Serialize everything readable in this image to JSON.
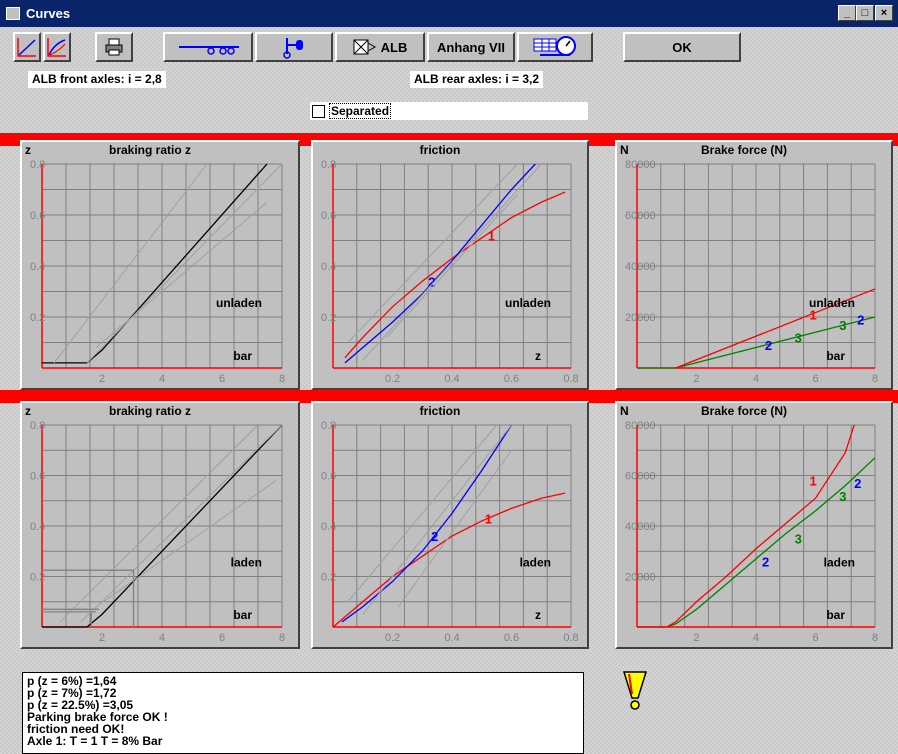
{
  "window": {
    "title": "Curves",
    "minimize": "_",
    "maximize": "□",
    "close": "×"
  },
  "toolbar": {
    "alb_label": "ALB",
    "anhang_label": "Anhang VII",
    "ok_label": "OK"
  },
  "info": {
    "front": "ALB front axles:   i = 2,8",
    "rear": "ALB rear axles:   i = 3,2"
  },
  "separated": {
    "label": "Separated",
    "checked": false
  },
  "colors": {
    "red": "#ff0000",
    "blue": "#0000ff",
    "green": "#008000",
    "grid": "#7f7f7f"
  },
  "log_lines": [
    "p (z = 6%) =1,64",
    "p (z = 7%) =1,72",
    "p (z = 22.5%) =3,05",
    "Parking brake force OK !",
    "friction need OK!",
    "Axle 1: T = 1 T = 8% Bar"
  ],
  "warning_icon": "exclamation-warning-icon",
  "chart_data": [
    {
      "type": "line",
      "title": "braking ratio z",
      "corner_label": "z",
      "annotation": "unladen",
      "xlabel": "bar",
      "xlim": [
        0,
        8
      ],
      "ylim": [
        0,
        0.8
      ],
      "xticks": [
        "2",
        "4",
        "6",
        "8"
      ],
      "yticks": [
        "0.2",
        "0.4",
        "0.6",
        "0.8"
      ],
      "series": [
        {
          "color": "#000000",
          "points": [
            [
              0,
              0.02
            ],
            [
              1.5,
              0.02
            ],
            [
              2,
              0.07
            ],
            [
              7.5,
              0.8
            ]
          ]
        },
        {
          "color": "#a0a0a0",
          "points": [
            [
              0.4,
              0.02
            ],
            [
              5.5,
              0.8
            ]
          ]
        },
        {
          "color": "#a0a0a0",
          "points": [
            [
              1.5,
              0.02
            ],
            [
              8,
              0.8
            ]
          ]
        },
        {
          "color": "#a0a0a0",
          "points": [
            [
              1.8,
              0.08
            ],
            [
              7.5,
              0.65
            ]
          ]
        }
      ]
    },
    {
      "type": "line",
      "title": "friction",
      "corner_label": "",
      "annotation": "unladen",
      "xlabel": "z",
      "xlim": [
        0,
        0.8
      ],
      "ylim": [
        0,
        0.8
      ],
      "xticks": [
        "0.2",
        "0.4",
        "0.6",
        "0.8"
      ],
      "yticks": [
        "0.2",
        "0.4",
        "0.6",
        "0.8"
      ],
      "series": [
        {
          "color": "#ff0000",
          "label": "1",
          "label_at": [
            0.52,
            0.5
          ],
          "points": [
            [
              0.04,
              0.04
            ],
            [
              0.1,
              0.12
            ],
            [
              0.2,
              0.24
            ],
            [
              0.3,
              0.34
            ],
            [
              0.4,
              0.43
            ],
            [
              0.5,
              0.51
            ],
            [
              0.6,
              0.59
            ],
            [
              0.7,
              0.65
            ],
            [
              0.78,
              0.69
            ]
          ]
        },
        {
          "color": "#0000ff",
          "label": "2",
          "label_at": [
            0.32,
            0.32
          ],
          "points": [
            [
              0.04,
              0.02
            ],
            [
              0.1,
              0.08
            ],
            [
              0.2,
              0.18
            ],
            [
              0.3,
              0.29
            ],
            [
              0.4,
              0.42
            ],
            [
              0.5,
              0.56
            ],
            [
              0.6,
              0.7
            ],
            [
              0.68,
              0.8
            ]
          ]
        },
        {
          "color": "#a0a0a0",
          "points": [
            [
              0.1,
              0.03
            ],
            [
              0.7,
              0.8
            ]
          ]
        },
        {
          "color": "#a0a0a0",
          "points": [
            [
              0.05,
              0.1
            ],
            [
              0.62,
              0.8
            ]
          ]
        },
        {
          "color": "#a0a0a0",
          "points": [
            [
              0.18,
              0.12
            ],
            [
              0.62,
              0.68
            ]
          ]
        }
      ]
    },
    {
      "type": "line",
      "title": "Brake force (N)",
      "corner_label": "N",
      "annotation": "unladen",
      "xlabel": "bar",
      "xlim": [
        0,
        8
      ],
      "ylim": [
        0,
        80000
      ],
      "xticks": [
        "2",
        "4",
        "6",
        "8"
      ],
      "yticks": [
        "20000",
        "40000",
        "60000",
        "80000"
      ],
      "series": [
        {
          "color": "#008000",
          "points": [
            [
              0,
              0
            ],
            [
              1.3,
              0
            ],
            [
              8,
              20000
            ]
          ]
        },
        {
          "color": "#ff0000",
          "label": "1",
          "label_at": [
            5.8,
            19000
          ],
          "points": [
            [
              1.3,
              0
            ],
            [
              8,
              31000
            ]
          ]
        },
        {
          "color": "#0000ff",
          "label": "2",
          "label_at": [
            4.3,
            7000
          ]
        },
        {
          "color": "#008000",
          "label": "3",
          "label_at": [
            5.3,
            10000
          ]
        },
        {
          "color": "#008000",
          "label": "3",
          "label_at": [
            6.8,
            15000
          ]
        },
        {
          "color": "#0000ff",
          "label": "2",
          "label_at": [
            7.4,
            17000
          ]
        }
      ]
    },
    {
      "type": "line",
      "title": "braking ratio z",
      "corner_label": "z",
      "annotation": "laden",
      "xlabel": "bar",
      "xlim": [
        0,
        8
      ],
      "ylim": [
        0,
        0.8
      ],
      "xticks": [
        "2",
        "4",
        "6",
        "8"
      ],
      "yticks": [
        "0.2",
        "0.4",
        "0.6",
        "0.8"
      ],
      "series": [
        {
          "color": "#000000",
          "points": [
            [
              0,
              0
            ],
            [
              1.5,
              0
            ],
            [
              2,
              0.05
            ],
            [
              8,
              0.8
            ]
          ]
        },
        {
          "color": "#a0a0a0",
          "points": [
            [
              0.6,
              0.02
            ],
            [
              7.2,
              0.8
            ]
          ]
        },
        {
          "color": "#a0a0a0",
          "points": [
            [
              1.3,
              0.02
            ],
            [
              8,
              0.8
            ]
          ]
        },
        {
          "color": "#a0a0a0",
          "points": [
            [
              1.8,
              0.08
            ],
            [
              7.8,
              0.58
            ]
          ]
        },
        {
          "color": "#808080",
          "points": [
            [
              0,
              0.06
            ],
            [
              1.8,
              0.06
            ]
          ]
        },
        {
          "color": "#808080",
          "points": [
            [
              0,
              0.07
            ],
            [
              1.9,
              0.07
            ]
          ]
        },
        {
          "color": "#808080",
          "points": [
            [
              0,
              0.225
            ],
            [
              3.05,
              0.225
            ],
            [
              3.05,
              0
            ]
          ]
        },
        {
          "color": "#808080",
          "points": [
            [
              1.64,
              0
            ],
            [
              1.64,
              0.06
            ]
          ]
        }
      ]
    },
    {
      "type": "line",
      "title": "friction",
      "corner_label": "",
      "annotation": "laden",
      "xlabel": "z",
      "xlim": [
        0,
        0.8
      ],
      "ylim": [
        0,
        0.8
      ],
      "xticks": [
        "0.2",
        "0.4",
        "0.6",
        "0.8"
      ],
      "yticks": [
        "0.2",
        "0.4",
        "0.6",
        "0.8"
      ],
      "series": [
        {
          "color": "#ff0000",
          "label": "1",
          "label_at": [
            0.51,
            0.41
          ],
          "points": [
            [
              0,
              0
            ],
            [
              0.1,
              0.1
            ],
            [
              0.2,
              0.2
            ],
            [
              0.3,
              0.28
            ],
            [
              0.4,
              0.36
            ],
            [
              0.5,
              0.42
            ],
            [
              0.6,
              0.47
            ],
            [
              0.7,
              0.51
            ],
            [
              0.78,
              0.53
            ]
          ]
        },
        {
          "color": "#0000ff",
          "label": "2",
          "label_at": [
            0.33,
            0.34
          ],
          "points": [
            [
              0.03,
              0.02
            ],
            [
              0.1,
              0.08
            ],
            [
              0.2,
              0.18
            ],
            [
              0.3,
              0.3
            ],
            [
              0.4,
              0.45
            ],
            [
              0.5,
              0.62
            ],
            [
              0.6,
              0.8
            ]
          ]
        },
        {
          "color": "#a0a0a0",
          "points": [
            [
              0.1,
              0.05
            ],
            [
              0.6,
              0.8
            ]
          ]
        },
        {
          "color": "#a0a0a0",
          "points": [
            [
              0.05,
              0.1
            ],
            [
              0.55,
              0.8
            ]
          ]
        },
        {
          "color": "#a0a0a0",
          "points": [
            [
              0.22,
              0.08
            ],
            [
              0.6,
              0.7
            ]
          ]
        }
      ]
    },
    {
      "type": "line",
      "title": "Brake force (N)",
      "corner_label": "N",
      "annotation": "laden",
      "xlabel": "bar",
      "xlim": [
        0,
        8
      ],
      "ylim": [
        0,
        80000
      ],
      "xticks": [
        "2",
        "4",
        "6",
        "8"
      ],
      "yticks": [
        "20000",
        "40000",
        "60000",
        "80000"
      ],
      "series": [
        {
          "color": "#008000",
          "points": [
            [
              0,
              0
            ],
            [
              1,
              0
            ],
            [
              1.3,
              1200
            ],
            [
              2,
              7000
            ],
            [
              3,
              17000
            ],
            [
              4,
              27000
            ],
            [
              5,
              37000
            ],
            [
              6,
              46000
            ],
            [
              7,
              56000
            ],
            [
              8,
              67000
            ]
          ]
        },
        {
          "color": "#ff0000",
          "points": [
            [
              0,
              0
            ],
            [
              1,
              0
            ],
            [
              1.3,
              2000
            ],
            [
              2,
              10000
            ],
            [
              3,
              20000
            ],
            [
              4,
              31000
            ],
            [
              5,
              41000
            ],
            [
              6,
              51000
            ],
            [
              7,
              69000
            ],
            [
              7.3,
              80000
            ]
          ]
        },
        {
          "color": "#ff0000",
          "label": "1",
          "label_at": [
            5.8,
            56000
          ]
        },
        {
          "color": "#0000ff",
          "label": "2",
          "label_at": [
            4.2,
            24000
          ]
        },
        {
          "color": "#008000",
          "label": "3",
          "label_at": [
            5.3,
            33000
          ]
        },
        {
          "color": "#008000",
          "label": "3",
          "label_at": [
            6.8,
            50000
          ]
        },
        {
          "color": "#0000ff",
          "label": "2",
          "label_at": [
            7.3,
            55000
          ]
        }
      ]
    }
  ]
}
